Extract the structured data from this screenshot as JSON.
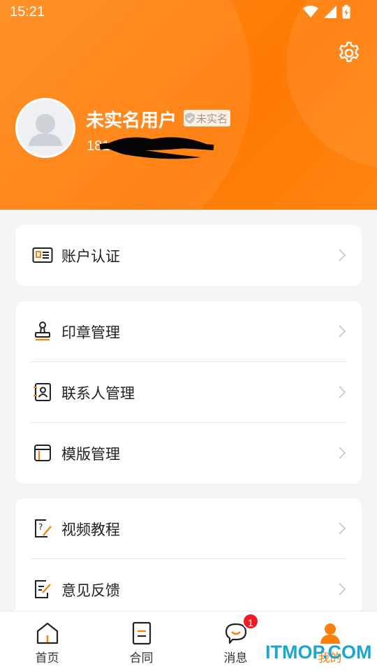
{
  "status_bar": {
    "time": "15:21"
  },
  "colors": {
    "accent": "#ff7f0a",
    "badge": "#ee1d23",
    "watermark": "#1aa6cf"
  },
  "profile": {
    "name": "未实名用户",
    "verify_badge": "未实名",
    "phone_prefix": "181"
  },
  "menu": {
    "group1": [
      {
        "label": "账户认证",
        "icon": "id-card-icon"
      }
    ],
    "group2": [
      {
        "label": "印章管理",
        "icon": "stamp-icon"
      },
      {
        "label": "联系人管理",
        "icon": "contact-book-icon"
      },
      {
        "label": "模版管理",
        "icon": "template-icon"
      }
    ],
    "group3": [
      {
        "label": "视频教程",
        "icon": "video-tutorial-icon"
      },
      {
        "label": "意见反馈",
        "icon": "feedback-icon"
      }
    ]
  },
  "tabbar": {
    "tabs": [
      {
        "label": "首页",
        "icon": "home-icon",
        "active": false
      },
      {
        "label": "合同",
        "icon": "contract-icon",
        "active": false
      },
      {
        "label": "消息",
        "icon": "message-icon",
        "active": false,
        "badge": "1"
      },
      {
        "label": "我的",
        "icon": "profile-icon",
        "active": true
      }
    ]
  },
  "watermark": "ITMOP.COM"
}
